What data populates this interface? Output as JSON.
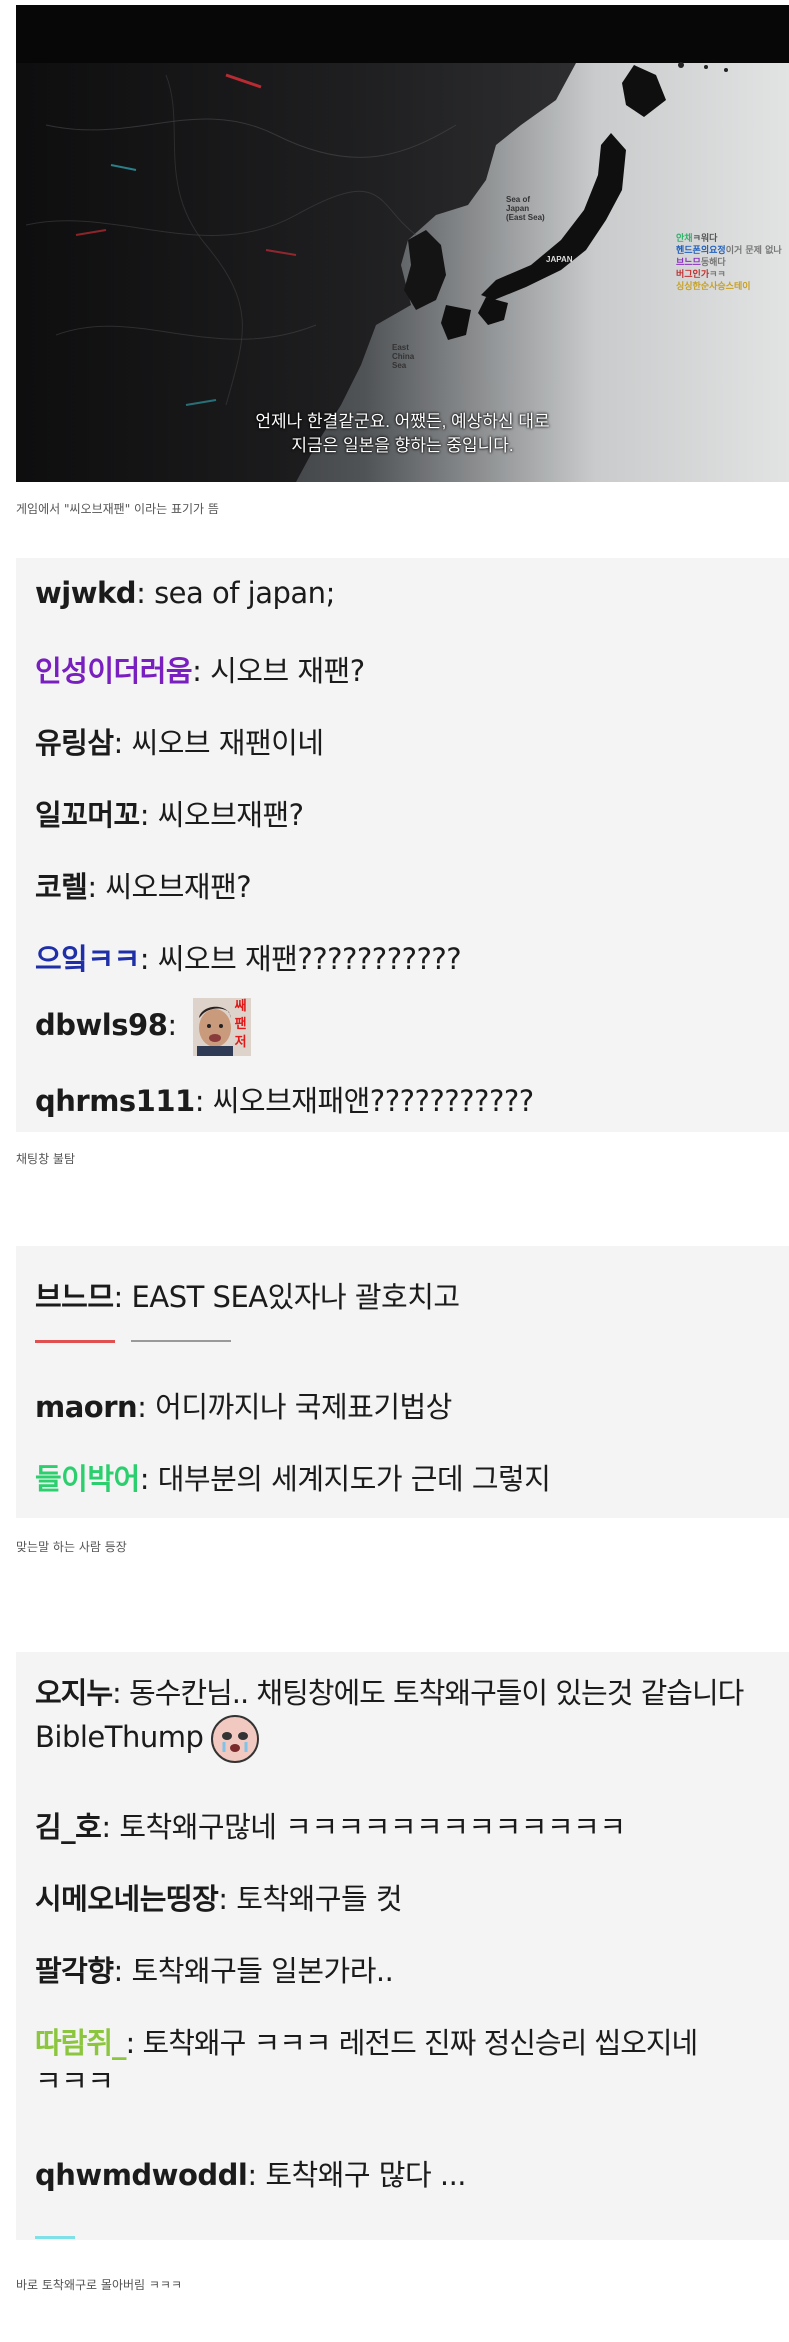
{
  "video": {
    "map_labels": {
      "sea_of_japan": "Sea of\nJapan\n(East Sea)",
      "japan": "JAPAN",
      "east_china_sea": "East\nChina\nSea"
    },
    "subtitle_line1": "언제나 한결같군요. 어쨌든, 예상하신 대로",
    "subtitle_line2": "지금은 일본을 향하는 중입니다.",
    "overlay_chat": [
      {
        "name": "안채",
        "msg": "ㅋ워다"
      },
      {
        "name": "헨드폰의요정",
        "msg": "이거 문제 없나"
      },
      {
        "name": "브느므",
        "msg": "동해다"
      },
      {
        "name": "버그인가",
        "msg": "ㅋㅋ"
      },
      {
        "name": "싱싱한순사승스테이",
        "msg": ""
      }
    ]
  },
  "captions": {
    "c1": "게임에서 \"씨오브재팬\" 이라는 표기가 뜸",
    "c2": "채팅창 불탐",
    "c3": "맞는말 하는 사람 등장",
    "c4": "바로 토착왜구로 몰아버림 ㅋㅋㅋ"
  },
  "chat1": [
    {
      "name": "wjwkd",
      "msg": ": sea of japan;"
    },
    {
      "name": "인성이더러움",
      "msg": ": 시오브 재팬?"
    },
    {
      "name": "유링삼",
      "msg": ": 씨오브 재팬이네"
    },
    {
      "name": "일꼬머꼬",
      "msg": ": 씨오브재팬?"
    },
    {
      "name": "코렐",
      "msg": ": 씨오브재팬?"
    },
    {
      "name": "으잌ㅋㅋ",
      "msg": ": 씨오브 재팬???????????"
    },
    {
      "name": "dbwls98",
      "msg": ":"
    },
    {
      "name": "qhrms111",
      "msg": ": 씨오브재패앤???????????"
    }
  ],
  "emote_text": "쌔\n팬\n저",
  "chat2": [
    {
      "name": "브느므",
      "msg": ": EAST SEA있자나 괄호치고"
    },
    {
      "name": "maorn",
      "msg": ": 어디까지나 국제표기법상"
    },
    {
      "name": "들이박어",
      "msg": ": 대부분의 세계지도가 근데 그렇지"
    }
  ],
  "chat3": [
    {
      "name": "오지누",
      "msg": ": 동수칸님.. 채팅창에도 토착왜구들이 있는것 같습니다"
    },
    {
      "name": "",
      "msg": "BibleThump"
    },
    {
      "name": "김_호",
      "msg": ": 토착왜구많네 ㅋㅋㅋㅋㅋㅋㅋㅋㅋㅋㅋㅋㅋ"
    },
    {
      "name": "시메오네는띵장",
      "msg": ": 토착왜구들 컷"
    },
    {
      "name": "팔각향",
      "msg": ": 토착왜구들 일본가라.."
    },
    {
      "name": "따람쥐_",
      "msg": ": 토착왜구 ㅋㅋㅋ 레전드 진짜 정신승리 씹오지네"
    },
    {
      "name": "",
      "msg": "ㅋㅋㅋ"
    },
    {
      "name": "qhwmdwoddl",
      "msg": ": 토착왜구 많다 ..."
    }
  ],
  "colors": {
    "panel_bg": "#f4f4f4",
    "text": "#1b1b1b",
    "name_purple": "#7a1fbf",
    "name_blue": "#1f2fa8",
    "name_green": "#2ccf6e",
    "name_lime": "#8cc63f",
    "caption": "#555555"
  }
}
